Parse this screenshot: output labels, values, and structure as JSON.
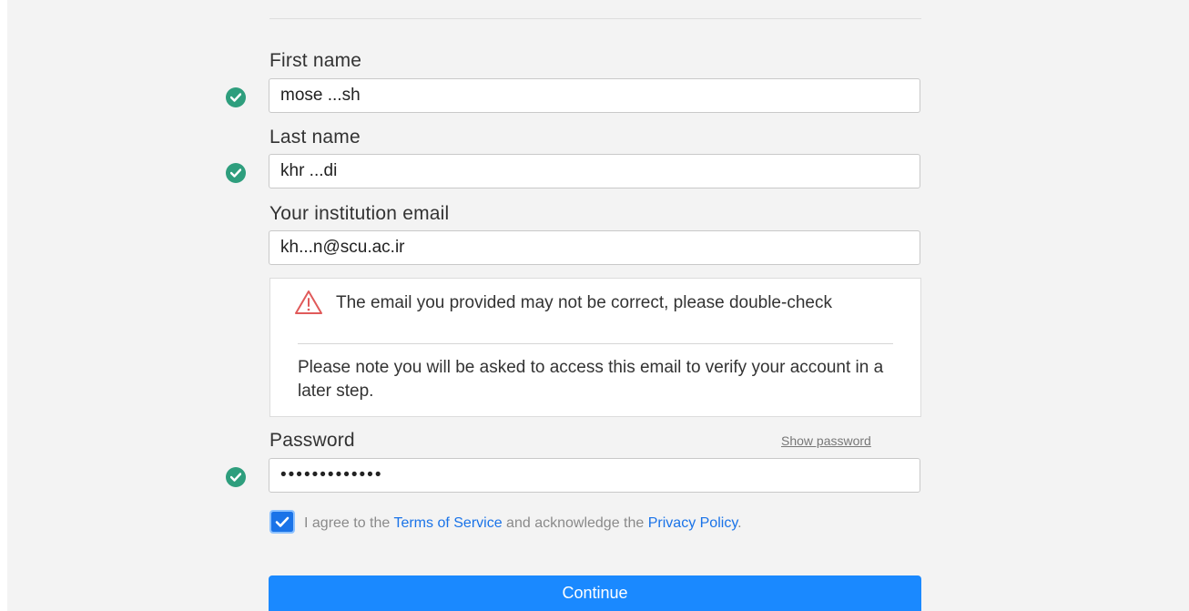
{
  "form": {
    "first_name": {
      "label": "First name",
      "value": "mose ...sh"
    },
    "last_name": {
      "label": "Last name",
      "value": "khr ...di"
    },
    "email": {
      "label": "Your institution email",
      "value": "kh...n@scu.ac.ir"
    },
    "email_notice": {
      "warning": "The email you provided may not be correct, please double-check",
      "info": "Please note you will be asked to access this email to verify your account in a later step."
    },
    "password": {
      "label": "Password",
      "value": "•••••••••••••",
      "show_password": "Show password"
    },
    "agree": {
      "prefix": "I agree to the",
      "terms_link": "Terms of Service",
      "middle": "and acknowledge the",
      "privacy_link": "Privacy Policy",
      "suffix": "."
    },
    "continue_label": "Continue"
  },
  "colors": {
    "valid": "#2e9e7d",
    "accent": "#1a73e8",
    "button": "#1a89ff",
    "warning": "#e05a5a"
  },
  "icons": {
    "valid": "check-circle-icon",
    "warning": "warning-triangle-icon",
    "checkbox": "checkmark-icon"
  }
}
